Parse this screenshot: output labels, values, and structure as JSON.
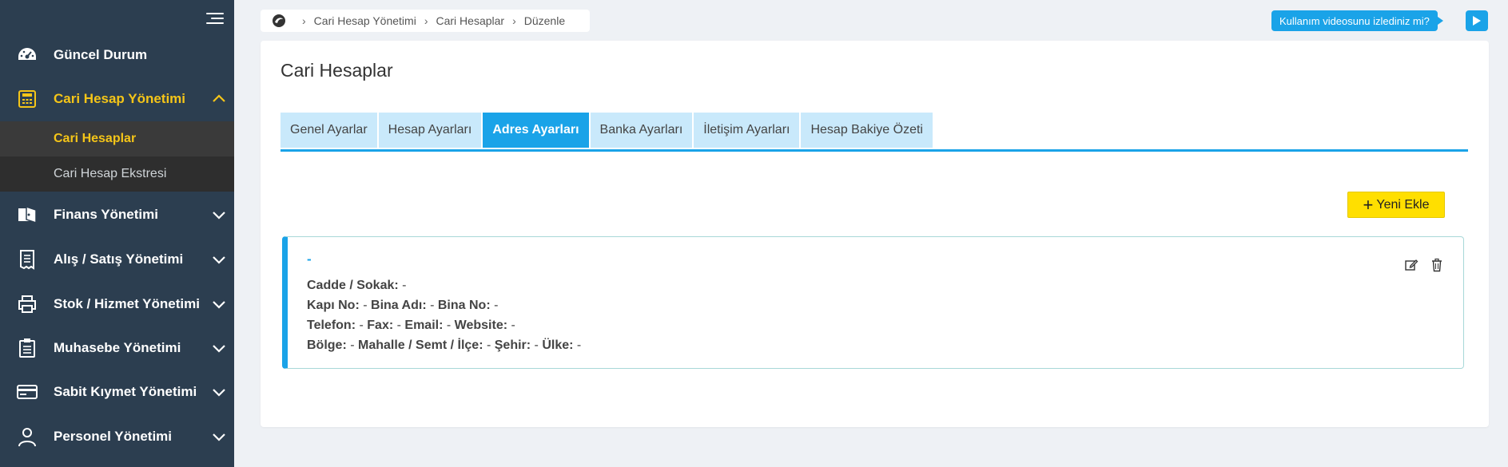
{
  "sidebar": {
    "items": [
      {
        "label": "Güncel Durum",
        "icon": "dashboard-icon"
      },
      {
        "label": "Cari Hesap Yönetimi",
        "icon": "calculator-icon",
        "active": true
      },
      {
        "label": "Finans Yönetimi",
        "icon": "finance-icon"
      },
      {
        "label": "Alış / Satış Yönetimi",
        "icon": "receipt-icon"
      },
      {
        "label": "Stok / Hizmet Yönetimi",
        "icon": "printer-icon"
      },
      {
        "label": "Muhasebe Yönetimi",
        "icon": "clipboard-icon"
      },
      {
        "label": "Sabit Kıymet Yönetimi",
        "icon": "card-icon"
      },
      {
        "label": "Personel Yönetimi",
        "icon": "user-icon"
      }
    ],
    "subitems": [
      {
        "label": "Cari Hesaplar",
        "active": true
      },
      {
        "label": "Cari Hesap Ekstresi"
      }
    ]
  },
  "breadcrumb": {
    "items": [
      "Cari Hesap Yönetimi",
      "Cari Hesaplar",
      "Düzenle"
    ]
  },
  "video": {
    "label": "Kullanım videosunu izlediniz mi?"
  },
  "page": {
    "title": "Cari Hesaplar"
  },
  "tabs": [
    {
      "label": "Genel Ayarlar"
    },
    {
      "label": "Hesap Ayarları"
    },
    {
      "label": "Adres Ayarları",
      "active": true
    },
    {
      "label": "Banka Ayarları"
    },
    {
      "label": "İletişim Ayarları"
    },
    {
      "label": "Hesap Bakiye Özeti"
    }
  ],
  "new_button": {
    "label": "Yeni Ekle"
  },
  "address": {
    "title": "-",
    "street_label": "Cadde / Sokak:",
    "street_value": "-",
    "door_label": "Kapı No:",
    "door_value": "-",
    "building_name_label": "Bina Adı:",
    "building_name_value": "-",
    "building_no_label": "Bina No:",
    "building_no_value": "-",
    "phone_label": "Telefon:",
    "phone_value": "-",
    "fax_label": "Fax:",
    "fax_value": "-",
    "email_label": "Email:",
    "email_value": "-",
    "website_label": "Website:",
    "website_value": "-",
    "region_label": "Bölge:",
    "region_value": "-",
    "district_label": "Mahalle / Semt / İlçe:",
    "district_value": "-",
    "city_label": "Şehir:",
    "city_value": "-",
    "country_label": "Ülke:",
    "country_value": "-"
  },
  "colors": {
    "sidebar": "#2c3e50",
    "accent": "#1aa3e8",
    "active_text": "#f5c518",
    "button": "#ffdf00"
  }
}
